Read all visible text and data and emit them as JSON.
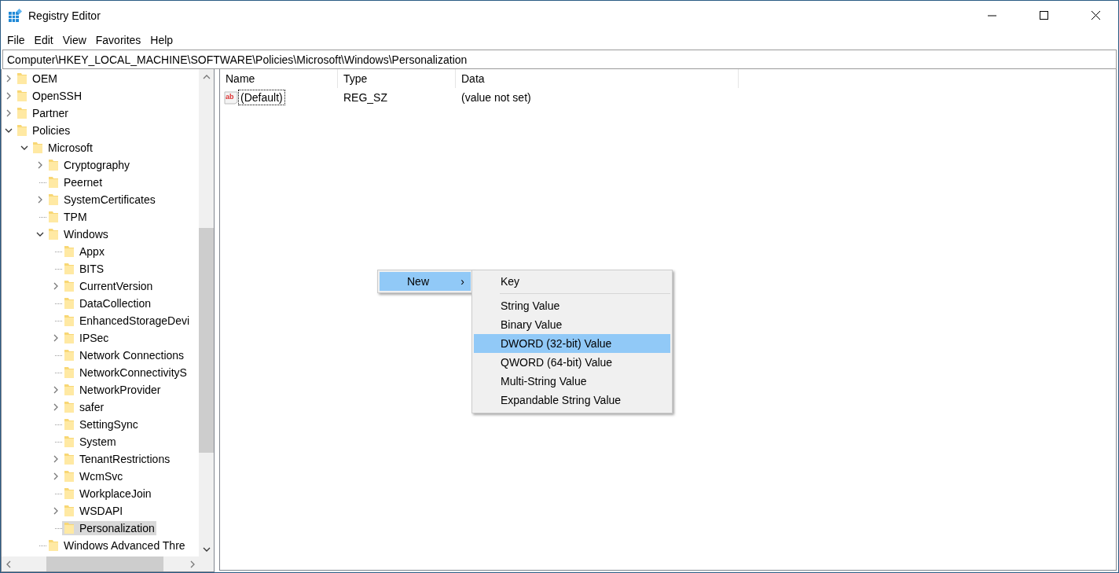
{
  "window": {
    "title": "Registry Editor"
  },
  "menu_bar": [
    "File",
    "Edit",
    "View",
    "Favorites",
    "Help"
  ],
  "address_bar": {
    "value": "Computer\\HKEY_LOCAL_MACHINE\\SOFTWARE\\Policies\\Microsoft\\Windows\\Personalization"
  },
  "tree": [
    {
      "kind": "branch",
      "label": "OEM",
      "expanded": false,
      "selected": false
    },
    {
      "kind": "branch",
      "label": "OpenSSH",
      "expanded": false,
      "selected": false
    },
    {
      "kind": "branch",
      "label": "Partner",
      "expanded": false,
      "selected": false
    },
    {
      "kind": "branch",
      "label": "Policies",
      "expanded": true,
      "selected": false,
      "children": [
        {
          "kind": "branch",
          "label": "Microsoft",
          "expanded": true,
          "selected": false,
          "children": [
            {
              "kind": "branch",
              "label": "Cryptography",
              "expanded": false,
              "selected": false
            },
            {
              "kind": "leaf",
              "label": "Peernet",
              "selected": false
            },
            {
              "kind": "branch",
              "label": "SystemCertificates",
              "expanded": false,
              "selected": false
            },
            {
              "kind": "leaf",
              "label": "TPM",
              "selected": false
            },
            {
              "kind": "branch",
              "label": "Windows",
              "expanded": true,
              "selected": false,
              "children": [
                {
                  "kind": "leaf",
                  "label": "Appx",
                  "selected": false
                },
                {
                  "kind": "leaf",
                  "label": "BITS",
                  "selected": false
                },
                {
                  "kind": "branch",
                  "label": "CurrentVersion",
                  "expanded": false,
                  "selected": false
                },
                {
                  "kind": "leaf",
                  "label": "DataCollection",
                  "selected": false
                },
                {
                  "kind": "leaf",
                  "label": "EnhancedStorageDevi",
                  "selected": false
                },
                {
                  "kind": "branch",
                  "label": "IPSec",
                  "expanded": false,
                  "selected": false
                },
                {
                  "kind": "leaf",
                  "label": "Network Connections",
                  "selected": false
                },
                {
                  "kind": "leaf",
                  "label": "NetworkConnectivityS",
                  "selected": false
                },
                {
                  "kind": "branch",
                  "label": "NetworkProvider",
                  "expanded": false,
                  "selected": false
                },
                {
                  "kind": "branch",
                  "label": "safer",
                  "expanded": false,
                  "selected": false
                },
                {
                  "kind": "leaf",
                  "label": "SettingSync",
                  "selected": false
                },
                {
                  "kind": "leaf",
                  "label": "System",
                  "selected": false
                },
                {
                  "kind": "branch",
                  "label": "TenantRestrictions",
                  "expanded": false,
                  "selected": false
                },
                {
                  "kind": "branch",
                  "label": "WcmSvc",
                  "expanded": false,
                  "selected": false
                },
                {
                  "kind": "leaf",
                  "label": "WorkplaceJoin",
                  "selected": false
                },
                {
                  "kind": "branch",
                  "label": "WSDAPI",
                  "expanded": false,
                  "selected": false
                },
                {
                  "kind": "leaf",
                  "label": "Personalization",
                  "selected": true
                }
              ]
            },
            {
              "kind": "leaf",
              "label": "Windows Advanced Thre",
              "selected": false
            }
          ]
        }
      ]
    }
  ],
  "table": {
    "columns": [
      "Name",
      "Type",
      "Data"
    ],
    "rows": [
      {
        "icon_text": "ab",
        "name": "(Default)",
        "type": "REG_SZ",
        "data": "(value not set)",
        "focused": true
      }
    ]
  },
  "context_menu": {
    "items": [
      {
        "label": "New",
        "arrow": "›",
        "selected": true
      }
    ]
  },
  "submenu": {
    "items": [
      {
        "kind": "item",
        "label": "Key",
        "selected": false
      },
      {
        "kind": "separator"
      },
      {
        "kind": "item",
        "label": "String Value",
        "selected": false
      },
      {
        "kind": "item",
        "label": "Binary Value",
        "selected": false
      },
      {
        "kind": "item",
        "label": "DWORD (32-bit) Value",
        "selected": true
      },
      {
        "kind": "item",
        "label": "QWORD (64-bit) Value",
        "selected": false
      },
      {
        "kind": "item",
        "label": "Multi-String Value",
        "selected": false
      },
      {
        "kind": "item",
        "label": "Expandable String Value",
        "selected": false
      }
    ]
  }
}
